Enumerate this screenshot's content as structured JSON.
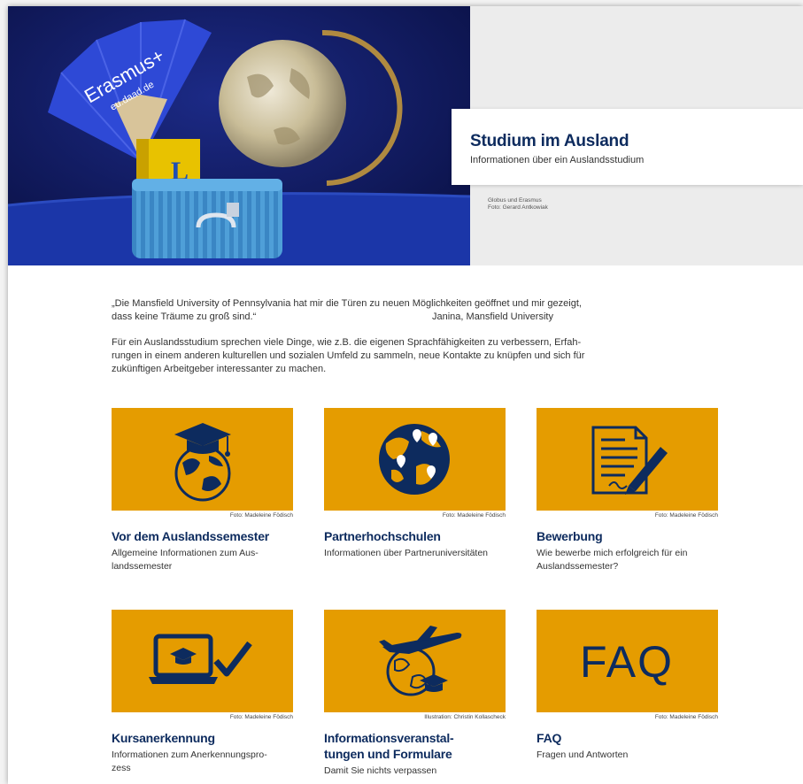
{
  "hero": {
    "title": "Studium im Ausland",
    "subtitle": "Informationen über ein Auslandsstudium",
    "credit_line1": "Globus und Erasmus",
    "credit_line2": "Foto: Gerard Antkowiak",
    "fan_text": "Erasmus+",
    "fan_url": "eu.daad.de"
  },
  "intro": {
    "quote_line1": "„Die Mansfield University of Pennsylvania hat mir die Türen zu neuen Möglichkeiten geöffnet und mir gezeigt,",
    "quote_line2": "dass keine Träume zu groß sind.“",
    "quote_author": "Janina, Mansfield University",
    "paragraph_line1": "Für ein Auslandsstudium sprechen viele Dinge, wie z.B. die eigenen Sprachfähigkeiten zu verbessern, Erfah-",
    "paragraph_line2": "rungen in einem anderen kulturellen und sozialen Umfeld zu sammeln, neue Kontakte zu knüpfen und sich für",
    "paragraph_line3": "zukünftigen Arbeitgeber interessanter zu machen."
  },
  "colors": {
    "accent": "#e59c00",
    "navy": "#0d2b5e"
  },
  "cards": [
    {
      "icon": "graduation-globe-icon",
      "credit": "Foto: Madeleine Födisch",
      "title_l1": "Vor dem Auslandssemester",
      "title_l2": "",
      "desc_l1": "Allgemeine Informationen zum Aus-",
      "desc_l2": "landssemester"
    },
    {
      "icon": "globe-pins-icon",
      "credit": "Foto: Madeleine Födisch",
      "title_l1": "Partnerhochschulen",
      "title_l2": "",
      "desc_l1": "Informationen über Partneruniversitäten",
      "desc_l2": ""
    },
    {
      "icon": "document-pen-icon",
      "credit": "Foto: Madeleine Födisch",
      "title_l1": "Bewerbung",
      "title_l2": "",
      "desc_l1": "Wie bewerbe mich erfolgreich für ein",
      "desc_l2": "Auslandssemester?"
    },
    {
      "icon": "laptop-check-icon",
      "credit": "Foto: Madeleine Födisch",
      "title_l1": "Kursanerkennung",
      "title_l2": "",
      "desc_l1": "Informationen zum Anerkennungspro-",
      "desc_l2": "zess"
    },
    {
      "icon": "plane-globe-icon",
      "credit": "Illustration: Christin Kollascheck",
      "title_l1": "Informationsveranstal-",
      "title_l2": "tungen und Formulare",
      "desc_l1": "Damit Sie nichts verpassen",
      "desc_l2": ""
    },
    {
      "icon": "faq-icon",
      "credit": "Foto: Madeleine Födisch",
      "title_l1": "FAQ",
      "title_l2": "",
      "desc_l1": "Fragen und Antworten",
      "desc_l2": "",
      "tile_text": "FAQ"
    }
  ]
}
